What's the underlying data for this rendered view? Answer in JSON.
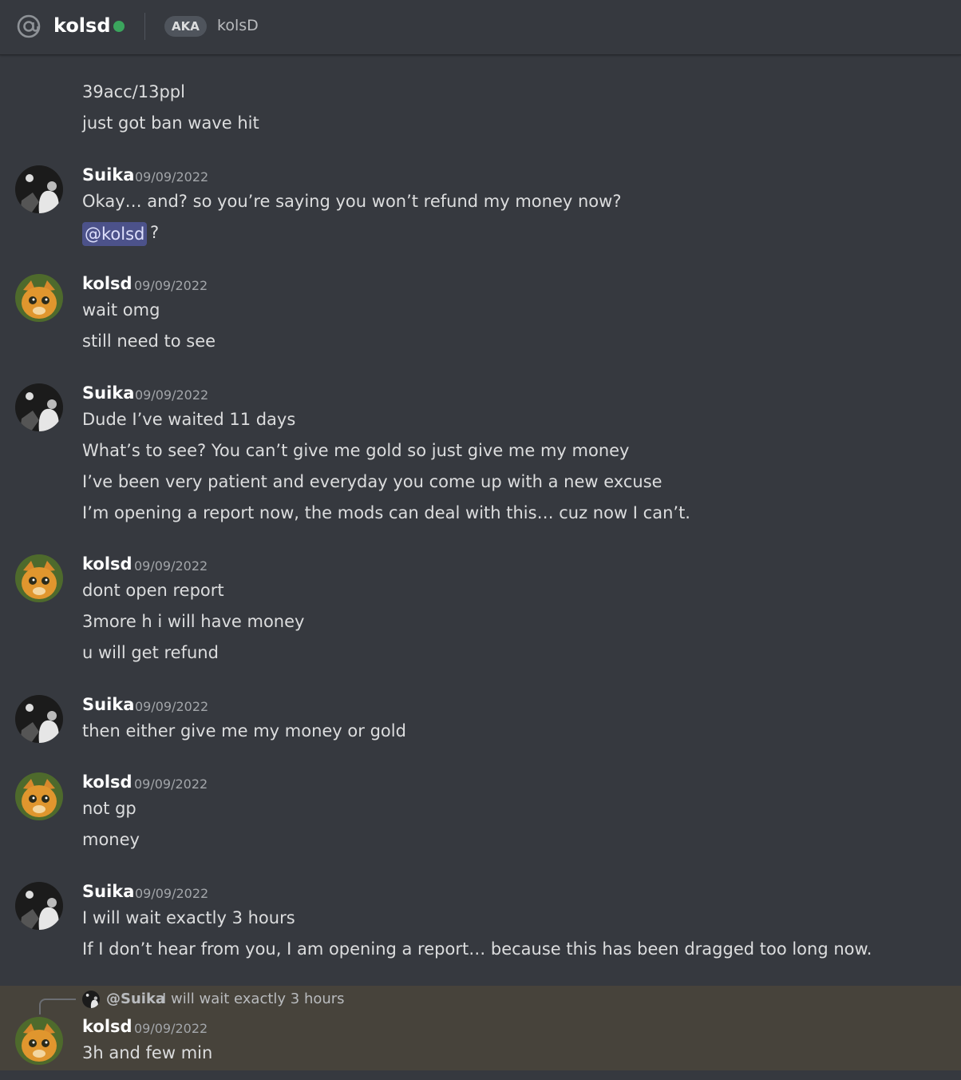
{
  "header": {
    "name": "kolsd",
    "aka_label": "AKA",
    "aka_name": "kolsD"
  },
  "messages": [
    {
      "lines": [
        "39acc/13ppl",
        "just got ban wave hit"
      ]
    },
    {
      "author": "Suika",
      "timestamp": "09/09/2022",
      "lines": [
        "Okay… and? so you’re saying you won’t refund my money now?"
      ],
      "mention": "@kolsd",
      "mention_suffix": "?"
    },
    {
      "author": "kolsd",
      "timestamp": "09/09/2022",
      "lines": [
        "wait omg",
        "still need to see"
      ]
    },
    {
      "author": "Suika",
      "timestamp": "09/09/2022",
      "lines": [
        "Dude I’ve waited 11 days",
        "What’s to see? You can’t give me gold so just give me my money",
        "I’ve been very patient and everyday you come up with a new excuse",
        "I’m opening a report now, the mods can deal with this… cuz now I can’t."
      ]
    },
    {
      "author": "kolsd",
      "timestamp": "09/09/2022",
      "lines": [
        "dont open report",
        "3more h i will have money",
        "u will get refund"
      ]
    },
    {
      "author": "Suika",
      "timestamp": "09/09/2022",
      "lines": [
        "then either give me my money or gold"
      ]
    },
    {
      "author": "kolsd",
      "timestamp": "09/09/2022",
      "lines": [
        "not gp",
        "money"
      ]
    },
    {
      "author": "Suika",
      "timestamp": "09/09/2022",
      "lines": [
        "I will wait exactly 3 hours",
        "If I don’t hear from you, I am opening a report… because this has been dragged too long now."
      ]
    },
    {
      "author": "kolsd",
      "timestamp": "09/09/2022",
      "reply_to": "@Suika",
      "reply_text": "I will wait exactly 3 hours",
      "lines": [
        "3h and few min"
      ]
    }
  ],
  "colors": {
    "background": "#36393f",
    "online": "#3ba55d",
    "mention_bg": "#4c528a",
    "highlight_bg": "#47433b"
  }
}
